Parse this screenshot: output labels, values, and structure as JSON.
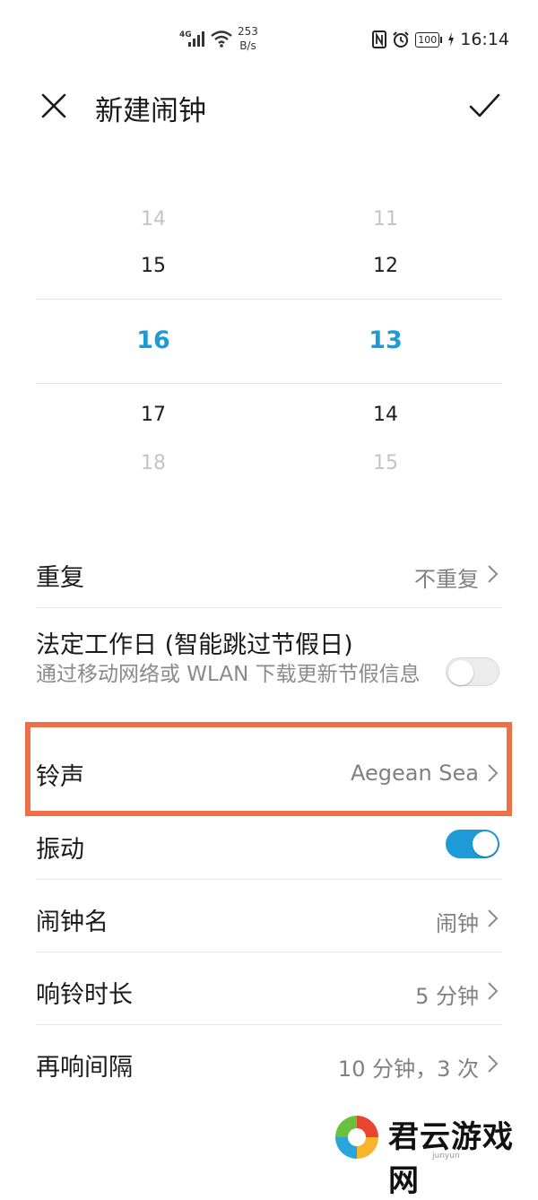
{
  "status_bar": {
    "network": "4G",
    "speed_value": "253",
    "speed_unit": "B/s",
    "battery": "100",
    "time": "16:14"
  },
  "header": {
    "title": "新建闹钟",
    "close_icon": "close-icon",
    "confirm_icon": "check-icon"
  },
  "time_picker": {
    "hours": [
      "14",
      "15",
      "16",
      "17",
      "18"
    ],
    "minutes": [
      "11",
      "12",
      "13",
      "14",
      "15"
    ],
    "selected_hour": "16",
    "selected_minute": "13"
  },
  "settings": {
    "repeat": {
      "label": "重复",
      "value": "不重复"
    },
    "workday": {
      "label": "法定工作日 (智能跳过节假日)",
      "description": "通过移动网络或 WLAN 下载更新节假信息",
      "enabled": false
    },
    "ringtone": {
      "label": "铃声",
      "value": "Aegean Sea"
    },
    "vibrate": {
      "label": "振动",
      "enabled": true
    },
    "alarm_name": {
      "label": "闹钟名",
      "value": "闹钟"
    },
    "ring_duration": {
      "label": "响铃时长",
      "value": "5 分钟"
    },
    "snooze": {
      "label": "再响间隔",
      "value": "10 分钟，3 次"
    }
  },
  "colors": {
    "accent": "#1f9ad8",
    "highlight": "#ee7049"
  },
  "watermark": {
    "brand": "君云游戏网",
    "url": "junyun"
  }
}
